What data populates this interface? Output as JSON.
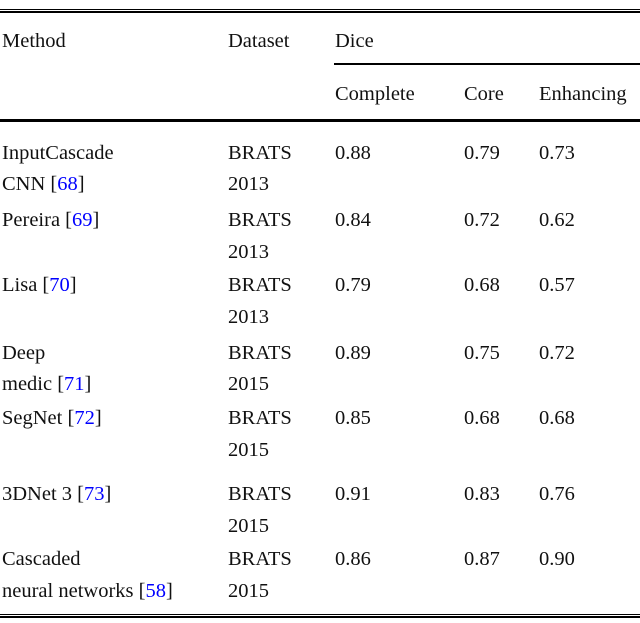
{
  "document": {
    "type": "academic-table",
    "caption_fragment": "",
    "link_color": "#0000FF",
    "text_color": "#111111",
    "background": "#ffffff"
  },
  "table": {
    "group_header": {
      "method": "Method",
      "dataset": "Dataset",
      "dice": "Dice"
    },
    "sub_header": {
      "complete": "Complete",
      "core": "Core",
      "enhancing": "Enhancing"
    },
    "columns": [
      "Method",
      "Dataset",
      "Complete",
      "Core",
      "Enhancing"
    ],
    "rows": [
      {
        "method_line1": "InputCascade",
        "method_line2_pre": "CNN [",
        "method_ref": "68",
        "method_line2_post": "]",
        "dataset_line1": "BRATS",
        "dataset_line2": "2013",
        "complete": "0.88",
        "core": "0.79",
        "enhancing": "0.73"
      },
      {
        "method_line1_pre": "Pereira [",
        "method_ref": "69",
        "method_line1_post": "]",
        "method_line2": "",
        "dataset_line1": "BRATS",
        "dataset_line2": "2013",
        "complete": "0.84",
        "core": "0.72",
        "enhancing": "0.62"
      },
      {
        "method_line1_pre": "Lisa [",
        "method_ref": "70",
        "method_line1_post": "]",
        "method_line2": "",
        "dataset_line1": "BRATS",
        "dataset_line2": "2013",
        "complete": "0.79",
        "core": "0.68",
        "enhancing": "0.57"
      },
      {
        "method_line1": "Deep",
        "method_line2_pre": "medic [",
        "method_ref": "71",
        "method_line2_post": "]",
        "dataset_line1": "BRATS",
        "dataset_line2": "2015",
        "complete": "0.89",
        "core": "0.75",
        "enhancing": "0.72"
      },
      {
        "method_line1_pre": "SegNet [",
        "method_ref": "72",
        "method_line1_post": "]",
        "method_line2": "",
        "dataset_line1": "BRATS",
        "dataset_line2": "2015",
        "complete": "0.85",
        "core": "0.68",
        "enhancing": "0.68"
      },
      {
        "method_line1_pre": "3DNet 3 [",
        "method_ref": "73",
        "method_line1_post": "]",
        "method_line2": "",
        "dataset_line1": "BRATS",
        "dataset_line2": "2015",
        "complete": "0.91",
        "core": "0.83",
        "enhancing": "0.76"
      },
      {
        "method_line1": "Cascaded",
        "method_line2_pre": "neural networks [",
        "method_ref": "58",
        "method_line2_post": "]",
        "dataset_line1": "BRATS",
        "dataset_line2": "2015",
        "complete": "0.86",
        "core": "0.87",
        "enhancing": "0.90"
      }
    ]
  }
}
